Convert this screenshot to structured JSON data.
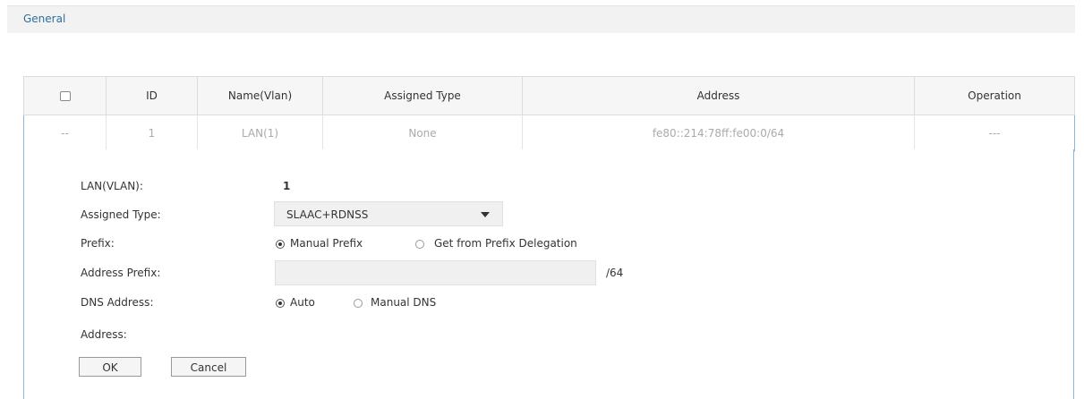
{
  "tabs": {
    "general": "General"
  },
  "grid": {
    "headers": {
      "id": "ID",
      "name": "Name(Vlan)",
      "type": "Assigned Type",
      "address": "Address",
      "operation": "Operation"
    },
    "row": {
      "check": "--",
      "id": "1",
      "name": "LAN(1)",
      "type": "None",
      "address": "fe80::214:78ff:fe00:0/64",
      "operation": "---"
    }
  },
  "form": {
    "lan_label": "LAN(VLAN):",
    "lan_value": "1",
    "assigned_type_label": "Assigned Type:",
    "assigned_type_value": "SLAAC+RDNSS",
    "prefix_label": "Prefix:",
    "prefix_opt_manual": "Manual Prefix",
    "prefix_opt_delegation": "Get from Prefix Delegation",
    "address_prefix_label": "Address Prefix:",
    "address_prefix_value": "",
    "address_prefix_suffix": "/64",
    "dns_label": "DNS Address:",
    "dns_opt_auto": "Auto",
    "dns_opt_manual": "Manual DNS",
    "address_label": "Address:",
    "ok": "OK",
    "cancel": "Cancel"
  }
}
